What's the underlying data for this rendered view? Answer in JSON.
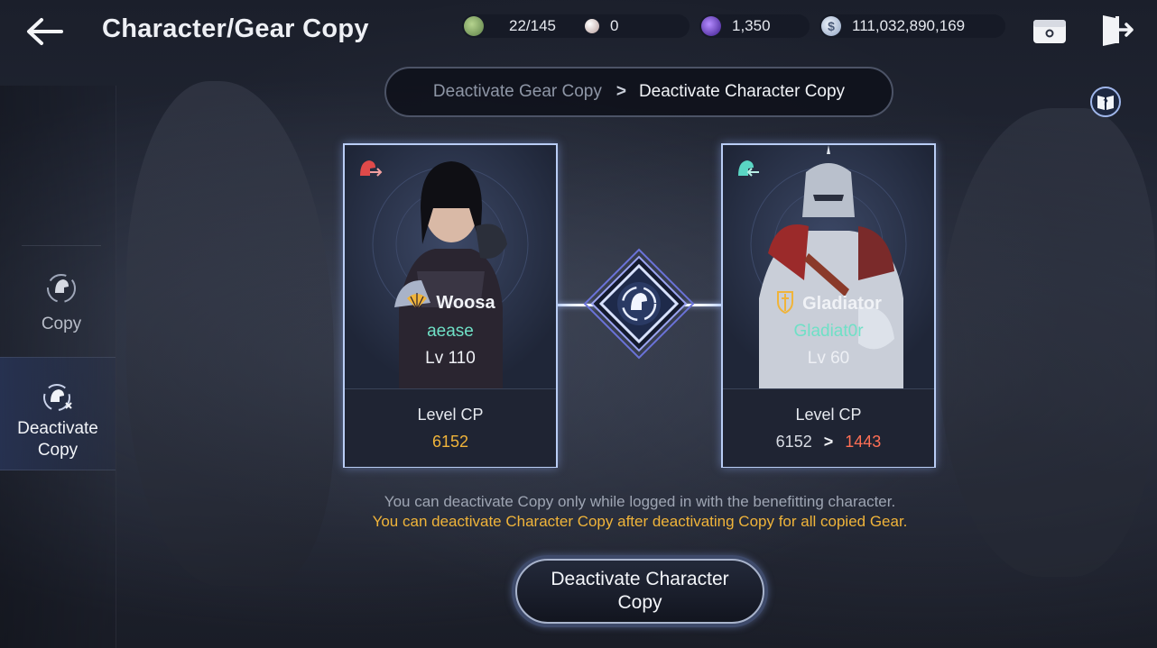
{
  "header": {
    "title": "Character/Gear Copy",
    "back_icon": "back-arrow-icon"
  },
  "resources": [
    {
      "icon": "green-stone-icon",
      "value": "22/145",
      "color": "#7fa86a"
    },
    {
      "icon": "pearl-icon",
      "value": "0",
      "color": "#d9c9c6"
    },
    {
      "icon": "purple-orb-icon",
      "value": "1,350",
      "color": "#6b3bd6"
    },
    {
      "icon": "silver-coin-icon",
      "value": "111,032,890,169",
      "color": "#c9d4e6"
    }
  ],
  "top_icons": [
    "storage-chest-icon",
    "exit-door-icon"
  ],
  "breadcrumb": {
    "step1": "Deactivate Gear Copy",
    "separator": ">",
    "step2": "Deactivate Character Copy"
  },
  "help_icon": "guide-book-icon",
  "sidebar": {
    "items": [
      {
        "label": "Copy",
        "icon": "copy-helmet-icon",
        "selected": false
      },
      {
        "label": "Deactivate\nCopy",
        "icon": "deactivate-copy-helmet-icon",
        "selected": true
      }
    ]
  },
  "source_card": {
    "corner_icon": "source-helmet-arrow-icon",
    "class_icon": "fan-class-icon",
    "class_name": "Woosa",
    "character_name": "aease",
    "level": "Lv  110",
    "cp_label": "Level CP",
    "cp_value": "6152"
  },
  "target_card": {
    "corner_icon": "target-helmet-arrow-icon",
    "class_icon": "sword-shield-class-icon",
    "class_name": "Gladiator",
    "character_name": "Gladiat0r",
    "level": "Lv  60",
    "cp_label": "Level CP",
    "cp_from": "6152",
    "cp_arrow": ">",
    "cp_to": "1443"
  },
  "center_icon": "copy-link-diamond-icon",
  "messages": {
    "info": "You can deactivate Copy only while logged in with the benefitting character.",
    "warning": "You can deactivate Character Copy after deactivating Copy for all copied Gear."
  },
  "action_button": {
    "label": "Deactivate Character Copy"
  },
  "colors": {
    "accent_teal": "#6fe0c6",
    "accent_gold": "#f0b43a",
    "cp_drop_red": "#ff6f55",
    "card_border": "#b9cdf5"
  }
}
